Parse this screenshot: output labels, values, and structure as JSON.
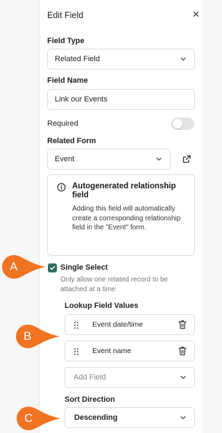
{
  "panel": {
    "title": "Edit Field",
    "close_icon": "close-icon"
  },
  "field_type": {
    "label": "Field Type",
    "value": "Related Field"
  },
  "field_name": {
    "label": "Field Name",
    "value": "Link our Events"
  },
  "required": {
    "label": "Required",
    "on": false
  },
  "related_form": {
    "label": "Related Form",
    "value": "Event",
    "open_icon": "external-link-icon"
  },
  "info": {
    "title": "Autogenerated relationship field",
    "text": "Adding this field will automatically create a corresponding relationship field in the \"Event\" form."
  },
  "single_select": {
    "label": "Single Select",
    "checked": true,
    "help": "Only allow one related record to be attached at a time"
  },
  "lookup": {
    "label": "Lookup Field Values",
    "items": [
      {
        "label": "Event date/time"
      },
      {
        "label": "Event name"
      }
    ],
    "add_placeholder": "Add Field"
  },
  "sort": {
    "label": "Sort Direction",
    "value": "Descending"
  },
  "markers": [
    {
      "letter": "A"
    },
    {
      "letter": "B"
    },
    {
      "letter": "C"
    }
  ],
  "colors": {
    "accent": "#2d6b60",
    "marker": "#f07322"
  }
}
